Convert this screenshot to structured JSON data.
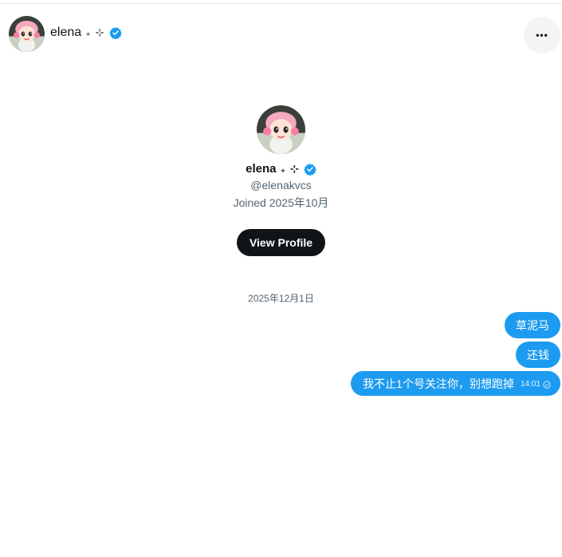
{
  "header": {
    "name": "elena",
    "decoration": "₊ ⊹",
    "more_label": "•••"
  },
  "profile": {
    "name": "elena",
    "decoration": "₊ ⊹",
    "handle": "@elenakvcs",
    "joined": "Joined 2025年10月",
    "view_button": "View Profile"
  },
  "conversation": {
    "date": "2025年12月1日",
    "messages": [
      {
        "text": "草泥马"
      },
      {
        "text": "还钱"
      },
      {
        "text": "我不止1个号关注你，别想跑掉",
        "time": "14:01"
      }
    ]
  },
  "colors": {
    "accent": "#1d9bf0",
    "button_dark": "#0f1419",
    "secondary_text": "#536471"
  },
  "icons": {
    "verified": "verified-badge-icon",
    "more": "more-horizontal-icon",
    "read_receipt": "check-circle-icon"
  }
}
